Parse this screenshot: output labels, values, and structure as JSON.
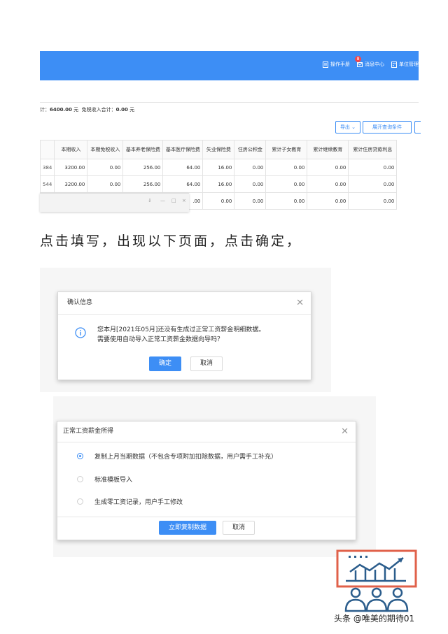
{
  "topbar": {
    "nav": [
      {
        "label": "操作手册",
        "icon": "book-icon"
      },
      {
        "label": "消息中心",
        "icon": "message-icon",
        "badge": "8"
      },
      {
        "label": "单位管理",
        "icon": "building-icon"
      }
    ]
  },
  "summary": {
    "total_prefix": "计：",
    "total_value": "6400.00",
    "total_unit": "元",
    "exempt_label": "免税收入合计：",
    "exempt_value": "0.00",
    "exempt_unit": "元"
  },
  "toolbar": {
    "export_label": "导出",
    "expand_label": "展开查询条件"
  },
  "table": {
    "headers": [
      "",
      "本期收入",
      "本期免税收入",
      "基本养老保险费",
      "基本医疗保险费",
      "失业保险费",
      "住房公积金",
      "累计子女教育",
      "累计继续教育",
      "累计住房贷款利息"
    ],
    "rows": [
      [
        "384",
        "3200.00",
        "0.00",
        "256.00",
        "64.00",
        "16.00",
        "0.00",
        "0.00",
        "0.00",
        "0.00"
      ],
      [
        "544",
        "3200.00",
        "0.00",
        "256.00",
        "64.00",
        "16.00",
        "0.00",
        "0.00",
        "0.00",
        "0.00"
      ],
      [
        "",
        "",
        "",
        "",
        ".00",
        "0.00",
        "0.00",
        "0.00",
        "0.00",
        "0.00"
      ]
    ]
  },
  "caption": "点击填写，出现以下页面，点击确定，",
  "confirm_dialog": {
    "title": "确认信息",
    "line1": "您本月[2021年05月]还没有生成过正常工资薪金明细数据。",
    "line2": "需要使用自动导入正常工资薪金数据向导吗？",
    "ok_label": "确定",
    "cancel_label": "取消"
  },
  "salary_dialog": {
    "title": "正常工资薪金所得",
    "options": [
      {
        "label": "复制上月当期数据（不包含专项附加扣除数据，用户需手工补充）",
        "selected": true
      },
      {
        "label": "标准模板导入",
        "selected": false
      },
      {
        "label": "生成零工资记录，用户手工修改",
        "selected": false
      }
    ],
    "ok_label": "立即复制数据",
    "cancel_label": "取消"
  },
  "watermark": "头条 @唯美的期待01",
  "colors": {
    "accent": "#3d8ef5",
    "badge": "#f5464a",
    "logo_frame": "#e0614a",
    "logo_blue": "#2b5d8c"
  }
}
